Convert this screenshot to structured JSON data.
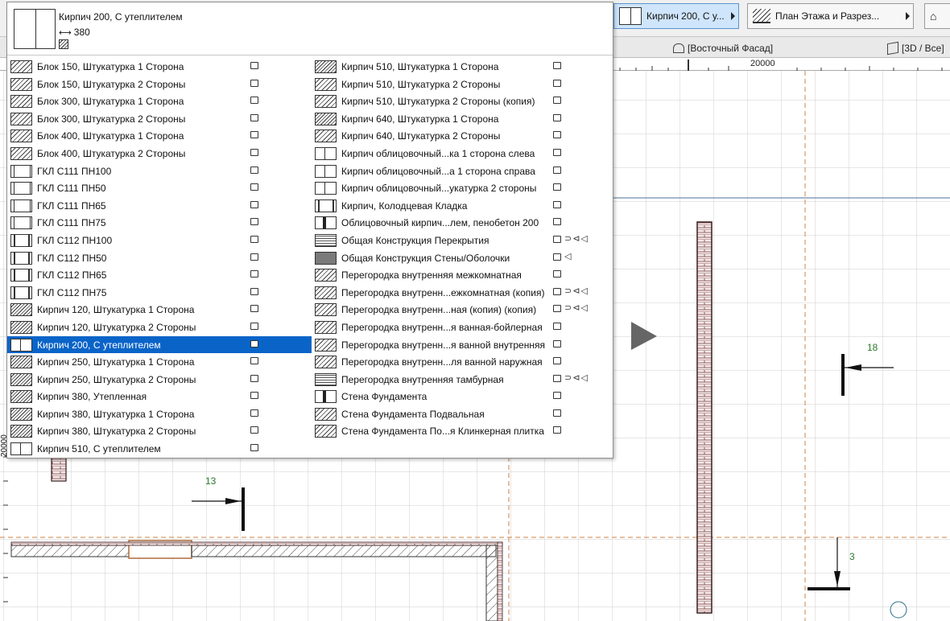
{
  "toolbar": {
    "composite_button": "Кирпич 200, С у...",
    "view_button": "План Этажа и Разрез..."
  },
  "tabs": {
    "east_facade": "[Восточный Фасад]",
    "view_3d": "[3D / Все]"
  },
  "ruler": {
    "label": "20000"
  },
  "popup": {
    "header": {
      "name": "Кирпич 200, С утеплителем",
      "thickness": "380"
    },
    "left_items": [
      {
        "label": "Блок 150, Штукатурка 1 Сторона",
        "swatch": "hatch"
      },
      {
        "label": "Блок 150, Штукатурка 2 Стороны",
        "swatch": "hatch"
      },
      {
        "label": "Блок 300, Штукатурка 1 Сторона",
        "swatch": "hatch"
      },
      {
        "label": "Блок 300, Штукатурка 2 Стороны",
        "swatch": "hatch"
      },
      {
        "label": "Блок 400, Штукатурка 1 Сторона",
        "swatch": "hatch"
      },
      {
        "label": "Блок 400, Штукатурка 2 Стороны",
        "swatch": "hatch"
      },
      {
        "label": "ГКЛ С111 ПН100",
        "swatch": "gkl"
      },
      {
        "label": "ГКЛ С111 ПН50",
        "swatch": "gkl"
      },
      {
        "label": "ГКЛ С111 ПН65",
        "swatch": "gkl"
      },
      {
        "label": "ГКЛ С111 ПН75",
        "swatch": "gkl"
      },
      {
        "label": "ГКЛ С112 ПН100",
        "swatch": "gkl2"
      },
      {
        "label": "ГКЛ С112 ПН50",
        "swatch": "gkl2"
      },
      {
        "label": "ГКЛ С112 ПН65",
        "swatch": "gkl2"
      },
      {
        "label": "ГКЛ С112 ПН75",
        "swatch": "gkl2"
      },
      {
        "label": "Кирпич 120, Штукатурка 1 Сторона",
        "swatch": "hatch-dense"
      },
      {
        "label": "Кирпич 120, Штукатурка 2 Стороны",
        "swatch": "hatch-dense"
      },
      {
        "label": "Кирпич 200, С утеплителем",
        "swatch": "brick-ins",
        "selected": true
      },
      {
        "label": "Кирпич 250, Штукатурка 1 Сторона",
        "swatch": "hatch-dense"
      },
      {
        "label": "Кирпич 250, Штукатурка 2 Стороны",
        "swatch": "hatch-dense"
      },
      {
        "label": "Кирпич 380, Утепленная",
        "swatch": "hatch-dense"
      },
      {
        "label": "Кирпич 380, Штукатурка 1 Сторона",
        "swatch": "hatch-dense"
      },
      {
        "label": "Кирпич 380, Штукатурка 2 Стороны",
        "swatch": "hatch-dense"
      },
      {
        "label": "Кирпич 510, С утеплителем",
        "swatch": "brick-ins"
      }
    ],
    "right_items": [
      {
        "label": "Кирпич 510, Штукатурка 1 Сторона",
        "swatch": "hatch-dense",
        "symbols": ""
      },
      {
        "label": "Кирпич 510, Штукатурка 2 Стороны",
        "swatch": "hatch",
        "symbols": ""
      },
      {
        "label": "Кирпич 510, Штукатурка 2 Стороны (копия)",
        "swatch": "hatch",
        "symbols": ""
      },
      {
        "label": "Кирпич 640, Штукатурка 1 Сторона",
        "swatch": "hatch-dense",
        "symbols": ""
      },
      {
        "label": "Кирпич 640, Штукатурка 2 Стороны",
        "swatch": "hatch",
        "symbols": ""
      },
      {
        "label": "Кирпич облицовочный...ка 1 сторона слева",
        "swatch": "brick-ins",
        "symbols": ""
      },
      {
        "label": "Кирпич облицовочный...а 1 сторона справа",
        "swatch": "brick-ins",
        "symbols": ""
      },
      {
        "label": "Кирпич облицовочный...укатурка 2 стороны",
        "swatch": "brick-ins",
        "symbols": ""
      },
      {
        "label": "Кирпич, Колодцевая Кладка",
        "swatch": "gkl2",
        "symbols": ""
      },
      {
        "label": "Облицовочный кирпич...лем, пенобетон 200",
        "swatch": "vbar",
        "symbols": ""
      },
      {
        "label": "Общая Конструкция Перекрытия",
        "swatch": "checker",
        "symbols": "⊃⊲◁"
      },
      {
        "label": "Общая Конструкция Стены/Оболочки",
        "swatch": "grey",
        "symbols": "  ◁"
      },
      {
        "label": "Перегородка внутренняя межкомнатная",
        "swatch": "hatch",
        "symbols": ""
      },
      {
        "label": "Перегородка внутренн...ежкомнатная (копия)",
        "swatch": "hatch",
        "symbols": "⊃⊲◁"
      },
      {
        "label": "Перегородка внутренн...ная (копия) (копия)",
        "swatch": "hatch",
        "symbols": "⊃⊲◁"
      },
      {
        "label": "Перегородка внутренн...я ванная-бойлерная",
        "swatch": "hatch",
        "symbols": ""
      },
      {
        "label": "Перегородка внутренн...я ванной внутренняя",
        "swatch": "hatch",
        "symbols": ""
      },
      {
        "label": "Перегородка внутренн...ля ванной наружная",
        "swatch": "hatch",
        "symbols": ""
      },
      {
        "label": "Перегородка внутренняя тамбурная",
        "swatch": "checker",
        "symbols": "⊃⊲◁"
      },
      {
        "label": "Стена Фундамента",
        "swatch": "vbar",
        "symbols": ""
      },
      {
        "label": "Стена Фундамента Подвальная",
        "swatch": "hatch",
        "symbols": ""
      },
      {
        "label": "Стена Фундамента По...я Клинкерная плитка",
        "swatch": "hatch",
        "symbols": ""
      }
    ]
  },
  "plan": {
    "marker_18": "18",
    "marker_13": "13",
    "marker_3": "3",
    "axis_label": "20000"
  }
}
